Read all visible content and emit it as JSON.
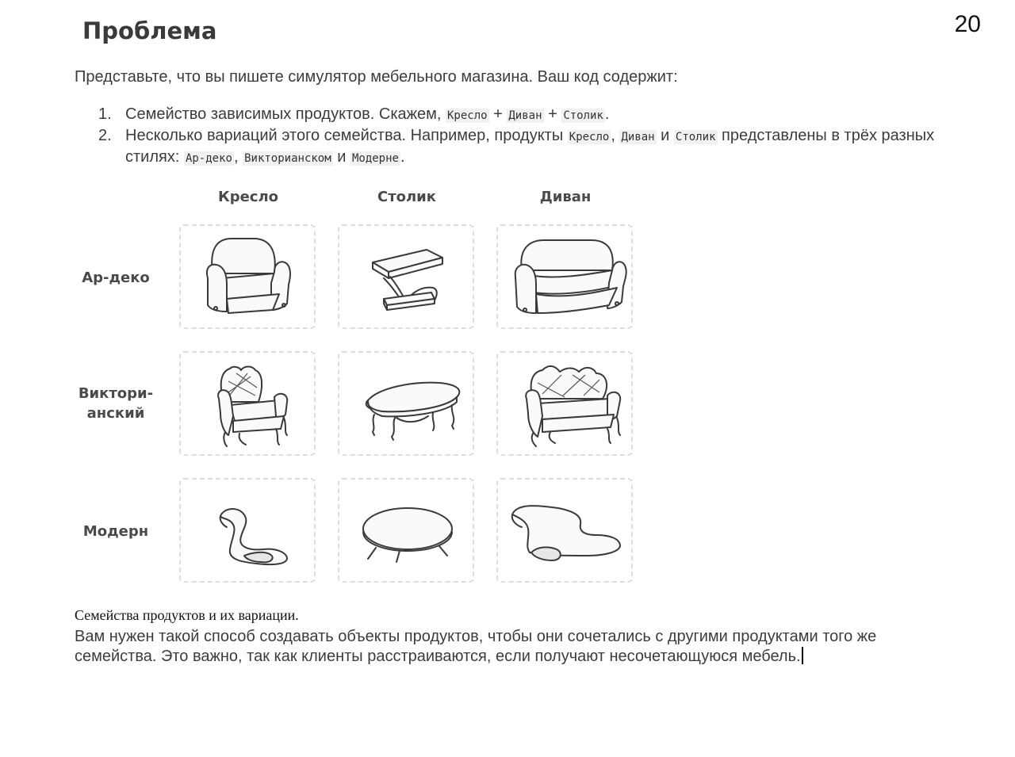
{
  "page_number": "20",
  "title": "Проблема",
  "intro": "Представьте, что вы пишете симулятор мебельного магазина. Ваш код содержит:",
  "list": [
    {
      "num": "1.",
      "t1": "Семейство зависимых продуктов. Скажем, ",
      "c1": "Кресло",
      "t2": " + ",
      "c2": "Диван",
      "t3": " + ",
      "c3": "Столик",
      "t4": "."
    },
    {
      "num": "2.",
      "t1": "Несколько вариаций этого семейства. Например, продукты ",
      "c1": "Кресло",
      "t2": ", ",
      "c2": "Диван",
      "t3": " и ",
      "c3": "Столик",
      "t4": " представлены в трёх разных стилях: ",
      "c4": "Ар-деко",
      "t5": ", ",
      "c5": "Викторианском",
      "t6": " и ",
      "c6": "Модерне",
      "t7": "."
    }
  ],
  "matrix": {
    "columns": [
      "Кресло",
      "Столик",
      "Диван"
    ],
    "rows": [
      {
        "label": "Ар-деко"
      },
      {
        "label1": "Виктори-",
        "label2": "анский"
      },
      {
        "label": "Модерн"
      }
    ]
  },
  "caption": "Семейства продуктов и их вариации.",
  "description": "Вам нужен такой способ создавать объекты продуктов, чтобы они сочетались с другими продуктами того же семейства. Это важно, так как клиенты расстраиваются, если получают несочетающуюся мебель."
}
